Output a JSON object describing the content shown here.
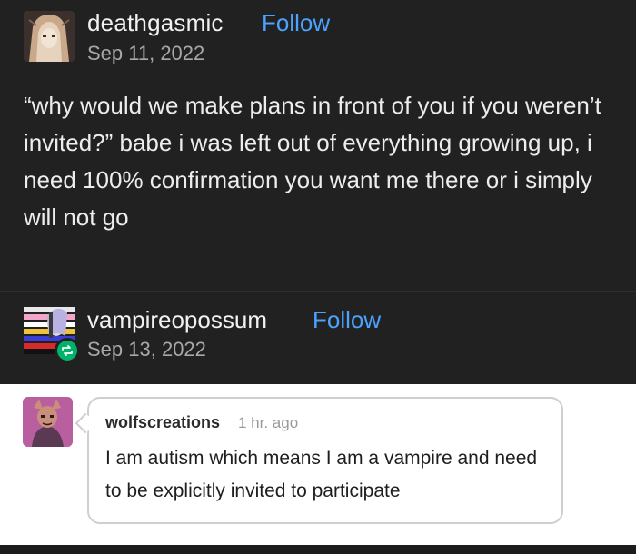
{
  "post": {
    "username": "deathgasmic",
    "follow_label": "Follow",
    "date": "Sep 11, 2022",
    "text": "“why would we make plans in front of you if you weren’t invited?” babe i was left out of everything growing up, i need 100% confirmation you want me there or i simply will not go"
  },
  "reblog": {
    "username": "vampireopossum",
    "follow_label": "Follow",
    "date": "Sep 13, 2022",
    "icon": "reblog-icon"
  },
  "reply": {
    "username": "wolfscreations",
    "time": "1 hr. ago",
    "text": "I am autism which means I am a vampire and need to be explicitly invited to participate"
  },
  "colors": {
    "background_dark": "#212121",
    "follow_blue": "#4aa3ff",
    "reblog_green": "#00b36b",
    "reply_background": "#ffffff"
  }
}
